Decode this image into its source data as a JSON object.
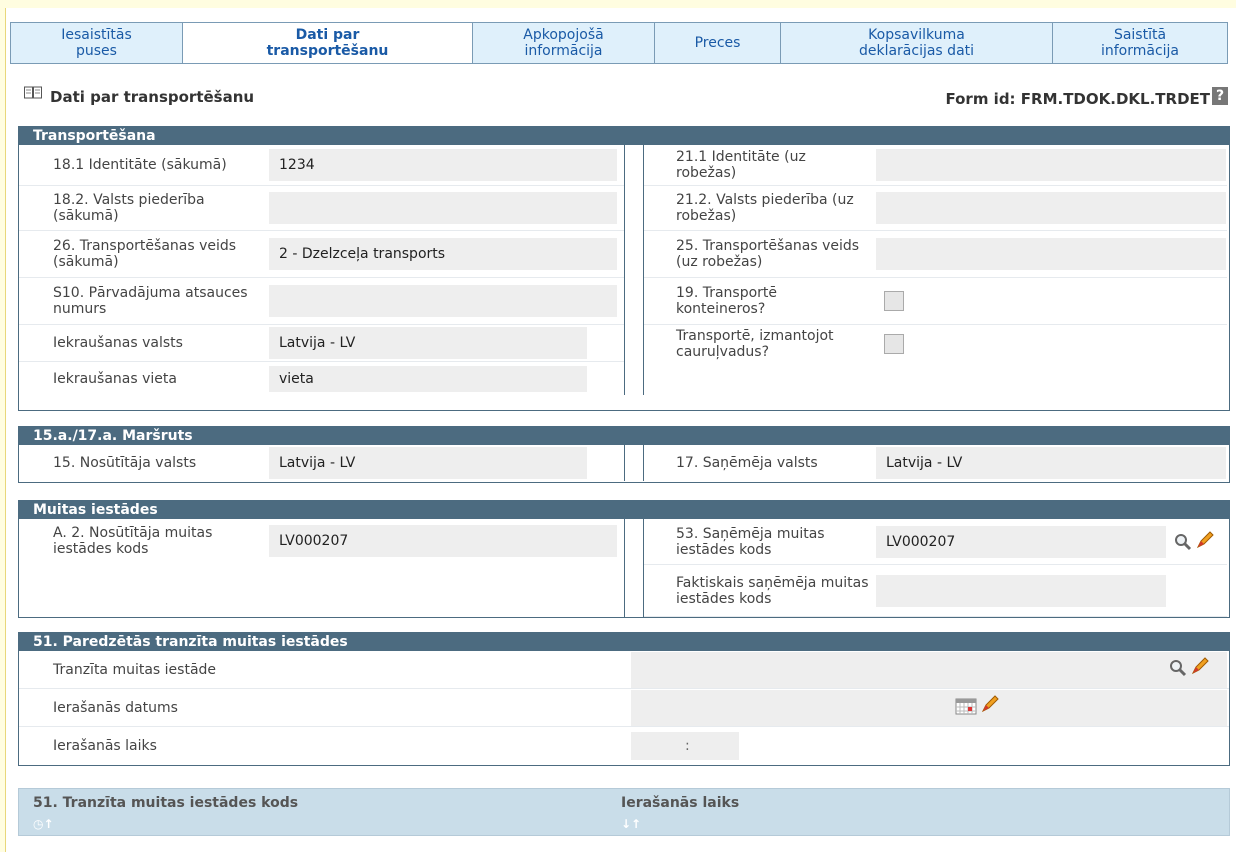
{
  "tabs": [
    {
      "label_1": "Iesaistītās",
      "label_2": "puses",
      "active": false
    },
    {
      "label_1": "Dati par",
      "label_2": "transportēšanu",
      "active": true
    },
    {
      "label_1": "Apkopojošā",
      "label_2": "informācija",
      "active": false
    },
    {
      "label_1": "Preces",
      "label_2": "",
      "active": false
    },
    {
      "label_1": "Kopsavilkuma",
      "label_2": "deklarācijas dati",
      "active": false
    },
    {
      "label_1": "Saistītā",
      "label_2": "informācija",
      "active": false
    }
  ],
  "page": {
    "title": "Dati par transportēšanu",
    "form_id": "Form id: FRM.TDOK.DKL.TRDET",
    "help": "?"
  },
  "transport": {
    "heading": "Transportēšana",
    "left": [
      {
        "label": "18.1 Identitāte (sākumā)",
        "value": "1234"
      },
      {
        "label": "18.2. Valsts piederība (sākumā)",
        "value": ""
      },
      {
        "label": "26. Transportēšanas veids (sākumā)",
        "value": "2 - Dzelzceļa transports"
      },
      {
        "label": "S10. Pārvadājuma atsauces numurs",
        "value": ""
      },
      {
        "label": "Iekraušanas valsts",
        "value": "Latvija - LV"
      },
      {
        "label": "Iekraušanas vieta",
        "value": "vieta"
      }
    ],
    "right": [
      {
        "label": "21.1 Identitāte (uz robežas)",
        "value": ""
      },
      {
        "label": "21.2. Valsts piederība (uz robežas)",
        "value": ""
      },
      {
        "label": "25. Transportēšanas veids (uz robežas)",
        "value": ""
      },
      {
        "label": "19. Transportē konteineros?",
        "checked": false
      },
      {
        "label": "Transportē, izmantojot cauruļvadus?",
        "checked": false
      }
    ]
  },
  "route": {
    "heading": "15.a./17.a. Maršruts",
    "left": {
      "label": "15. Nosūtītāja valsts",
      "value": "Latvija - LV"
    },
    "right": {
      "label": "17. Saņēmēja valsts",
      "value": "Latvija - LV"
    }
  },
  "customs": {
    "heading": "Muitas iestādes",
    "left": {
      "label": "A. 2. Nosūtītāja muitas iestādes kods",
      "value": "LV000207"
    },
    "right": [
      {
        "label": "53. Saņēmēja muitas iestādes kods",
        "value": "LV000207"
      },
      {
        "label": "Faktiskais saņēmēja muitas iestādes kods",
        "value": ""
      }
    ]
  },
  "transit": {
    "heading": "51. Paredzētās tranzīta muitas iestādes",
    "office_label": "Tranzīta muitas iestāde",
    "office_value": "",
    "date_label": "Ierašanās datums",
    "date_value": "",
    "time_label": "Ierašanās laiks",
    "time_sep": ":"
  },
  "grid": {
    "col1": "51. Tranzīta muitas iestādes kods",
    "col2": "Ierašanās laiks"
  },
  "colors": {
    "header": "#4c6b80",
    "tab_text": "#1a5aa6",
    "grid_header": "#c9dde9"
  }
}
